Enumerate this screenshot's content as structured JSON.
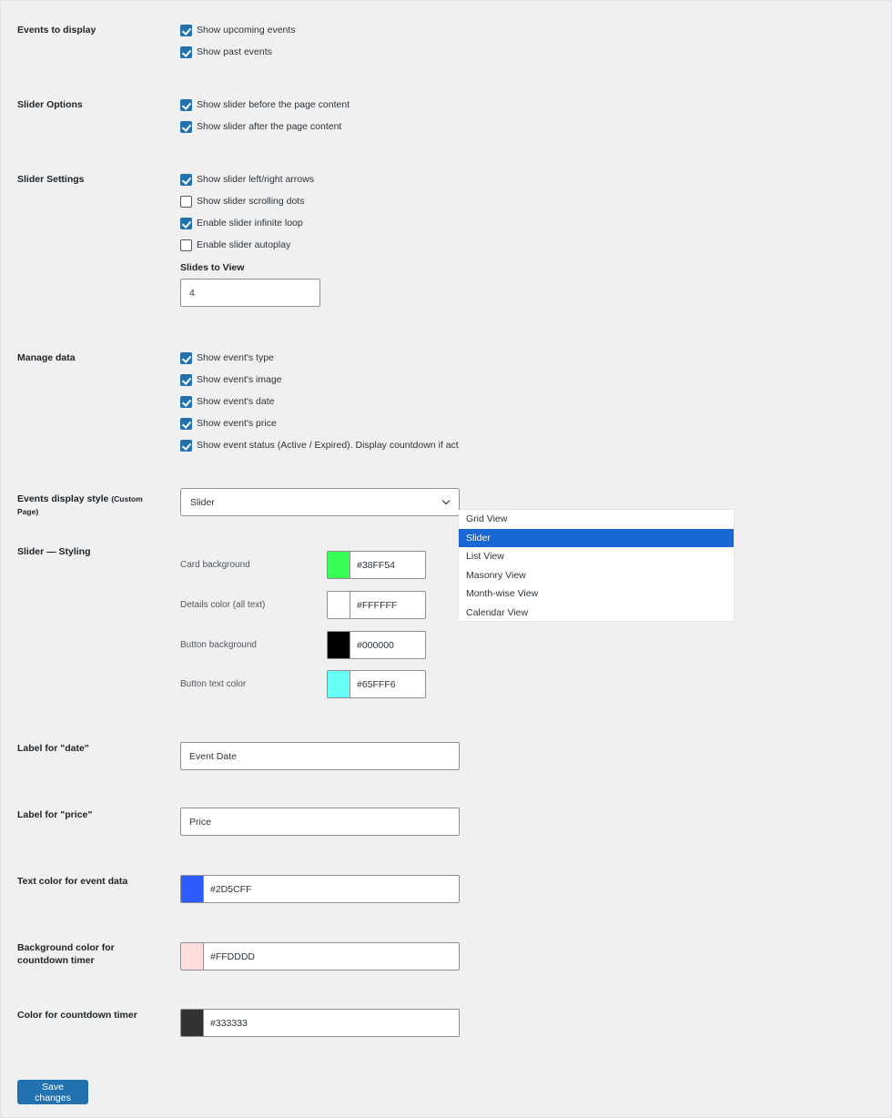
{
  "sections": {
    "events_to_display": {
      "label": "Events to display",
      "options": [
        {
          "label": "Show upcoming events",
          "checked": true
        },
        {
          "label": "Show past events",
          "checked": true
        }
      ]
    },
    "slider_options": {
      "label": "Slider Options",
      "options": [
        {
          "label": "Show slider before the page content",
          "checked": true
        },
        {
          "label": "Show slider after the page content",
          "checked": true
        }
      ]
    },
    "slider_settings": {
      "label": "Slider Settings",
      "options": [
        {
          "label": "Show slider left/right arrows",
          "checked": true
        },
        {
          "label": "Show slider scrolling dots",
          "checked": false
        },
        {
          "label": "Enable slider infinite loop",
          "checked": true
        },
        {
          "label": "Enable slider autoplay",
          "checked": false
        }
      ],
      "slides_to_view_label": "Slides to View",
      "slides_to_view_value": "4"
    },
    "manage_data": {
      "label": "Manage data",
      "options": [
        {
          "label": "Show event's type",
          "checked": true
        },
        {
          "label": "Show event's image",
          "checked": true
        },
        {
          "label": "Show event's date",
          "checked": true
        },
        {
          "label": "Show event's price",
          "checked": true
        },
        {
          "label": "Show event status (Active / Expired). Display countdown if act",
          "checked": true
        }
      ]
    },
    "display_style": {
      "label": "Events display style",
      "label_small": "(Custom Page)",
      "selected": "Slider",
      "options": [
        "Grid View",
        "Slider",
        "List View",
        "Masonry View",
        "Month-wise View",
        "Calendar View"
      ]
    },
    "slider_styling": {
      "label": "Slider — Styling",
      "fields": [
        {
          "label": "Card background",
          "value": "#38FF54",
          "color": "#38FF54"
        },
        {
          "label": "Details color (all text)",
          "value": "#FFFFFF",
          "color": "#FFFFFF"
        },
        {
          "label": "Button background",
          "value": "#000000",
          "color": "#000000"
        },
        {
          "label": "Button text color",
          "value": "#65FFF6",
          "color": "#65FFF6"
        }
      ]
    },
    "label_date": {
      "label": "Label for \"date\"",
      "value": "Event Date"
    },
    "label_price": {
      "label": "Label for \"price\"",
      "value": "Price"
    },
    "text_color": {
      "label": "Text color for event data",
      "value": "#2D5CFF",
      "color": "#2D5CFF"
    },
    "countdown_bg": {
      "label": "Background color for countdown timer",
      "value": "#FFDDDD",
      "color": "#FFDDDD"
    },
    "countdown_color": {
      "label": "Color for countdown timer",
      "value": "#333333",
      "color": "#333333"
    }
  },
  "save_label": "Save changes",
  "colors": {
    "primary": "#2271b1",
    "dropdown_highlight": "#1967d2",
    "background": "#f0f0f1"
  }
}
